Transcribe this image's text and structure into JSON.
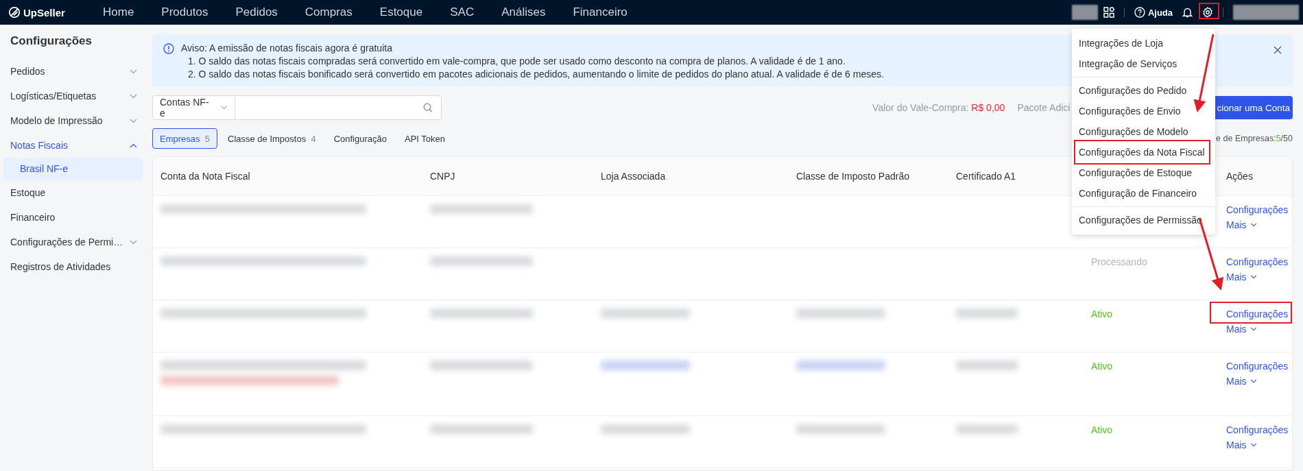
{
  "topbar": {
    "logo": "UpSeller",
    "nav": [
      "Home",
      "Produtos",
      "Pedidos",
      "Compras",
      "Estoque",
      "SAC",
      "Análises",
      "Financeiro"
    ],
    "help": "Ajuda"
  },
  "sidebar": {
    "title": "Configurações",
    "items": [
      {
        "label": "Pedidos",
        "expanded": false,
        "has_children": true,
        "selected": false
      },
      {
        "label": "Logísticas/Etiquetas",
        "expanded": false,
        "has_children": true,
        "selected": false
      },
      {
        "label": "Modelo de Impressão",
        "expanded": false,
        "has_children": true,
        "selected": false
      },
      {
        "label": "Notas Fiscais",
        "expanded": true,
        "has_children": true,
        "selected": true,
        "children": [
          {
            "label": "Brasil NF-e",
            "selected": true
          }
        ]
      },
      {
        "label": "Estoque",
        "has_children": false,
        "selected": false
      },
      {
        "label": "Financeiro",
        "has_children": false,
        "selected": false
      },
      {
        "label": "Configurações de Permi…",
        "expanded": false,
        "has_children": true,
        "selected": false
      },
      {
        "label": "Registros de Atividades",
        "has_children": false,
        "selected": false
      }
    ]
  },
  "notice": {
    "title": "Aviso: A emissão de notas fiscais agora é gratuita",
    "lines": [
      "1. O saldo das notas fiscais compradas será convertido em vale-compra, que pode ser usado como desconto na compra de planos. A validade é de 1 ano.",
      "2. O saldo das notas fiscais bonificado será convertido em pacotes adicionais de pedidos, aumentando o limite de pedidos do plano atual. A validade é de 6 meses."
    ]
  },
  "toolbar": {
    "select": "Contas NF-e",
    "voucher_label": "Valor do Vale-Compra:",
    "voucher_value": "R$ 0,00",
    "package_label": "Pacote Adici",
    "add_button": "cionar uma Conta",
    "count_label": "e de Empresas:",
    "count_used": "5",
    "count_total": "/50"
  },
  "tabs": [
    {
      "label": "Empresas",
      "count": "5",
      "selected": true
    },
    {
      "label": "Classe de Impostos",
      "count": "4",
      "selected": false
    },
    {
      "label": "Configuração",
      "selected": false
    },
    {
      "label": "API Token",
      "selected": false
    }
  ],
  "table": {
    "columns": [
      "Conta da Nota Fiscal",
      "CNPJ",
      "Loja Associada",
      "Classe de Imposto Padrão",
      "Certificado A1",
      "Ações"
    ],
    "rows": [
      {
        "actions": [
          "Configurações",
          "Mais"
        ]
      },
      {
        "status": "Processando",
        "color": "#b5b5b5",
        "actions": [
          "Configurações",
          "Mais"
        ]
      },
      {
        "status": "Ativo",
        "color": "#52c41a",
        "actions": [
          "Configurações",
          "Mais"
        ]
      },
      {
        "status": "Ativo",
        "color": "#52c41a",
        "actions": [
          "Configurações",
          "Mais"
        ]
      },
      {
        "status": "Ativo",
        "color": "#52c41a",
        "actions": [
          "Configurações",
          "Mais"
        ]
      }
    ]
  },
  "settings_menu": {
    "groups": [
      [
        "Integrações de Loja",
        "Integração de Serviços"
      ],
      [
        "Configurações do Pedido",
        "Configurações de Envio",
        "Configurações de Modelo",
        "Configurações da Nota Fiscal",
        "Configurações de Estoque",
        "Configuração de Financeiro"
      ],
      [
        "Configurações de Permissão"
      ]
    ]
  }
}
